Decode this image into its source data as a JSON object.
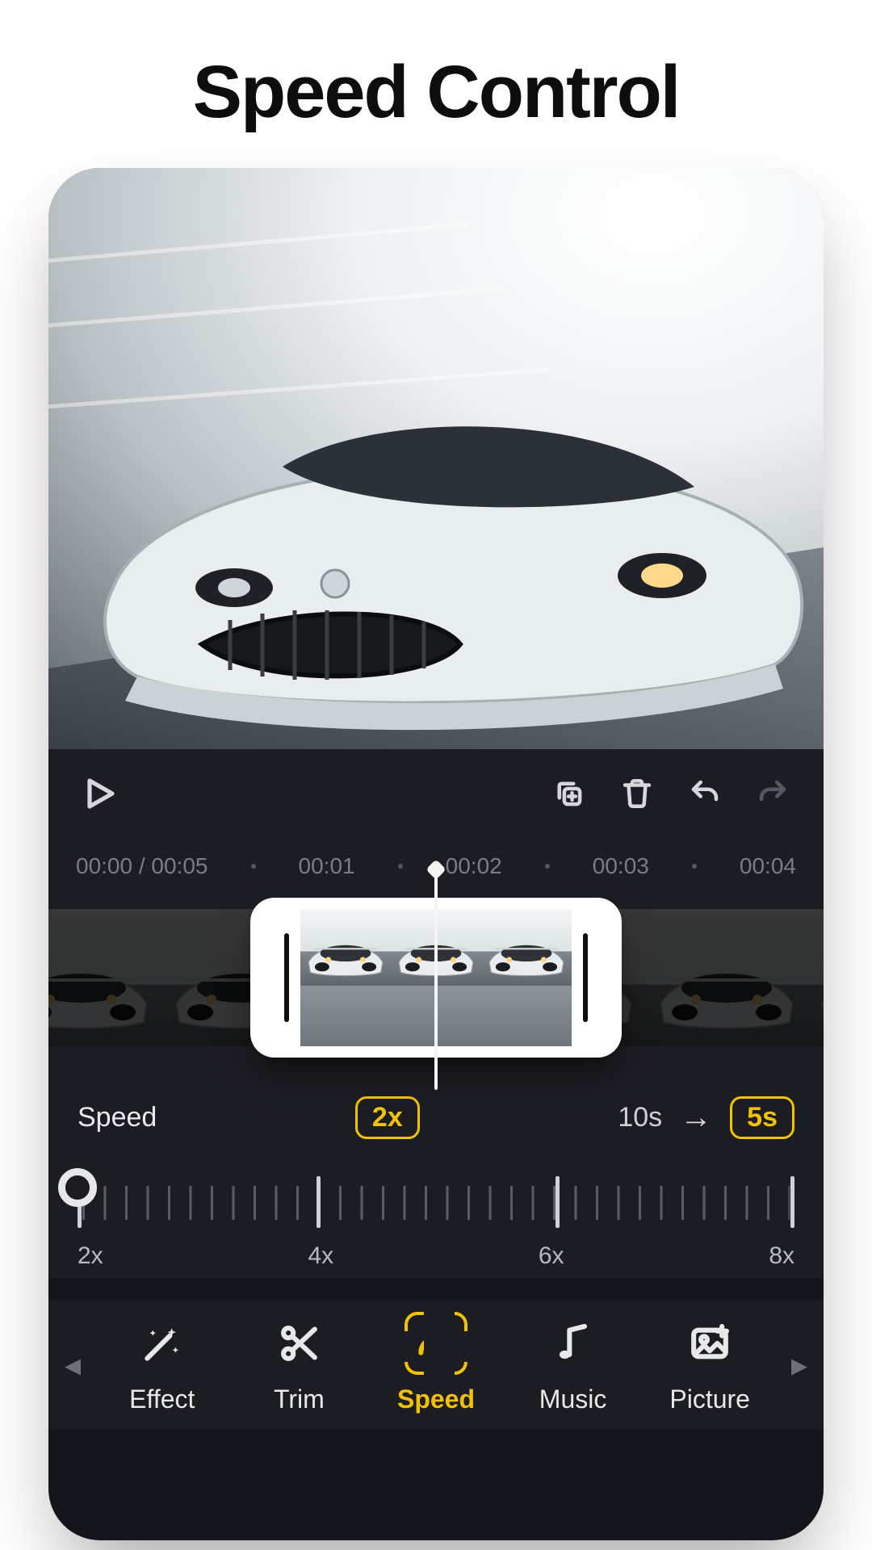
{
  "promo_title": "Speed Control",
  "toolbar": {
    "play_label": "Play",
    "duplicate_label": "Duplicate clip",
    "delete_label": "Delete",
    "undo_label": "Undo",
    "redo_label": "Redo"
  },
  "ruler": {
    "current_and_total": "00:00 / 00:05",
    "marks": [
      "00:01",
      "00:02",
      "00:03",
      "00:04"
    ]
  },
  "speed": {
    "label": "Speed",
    "multiplier": "2x",
    "from_duration": "10s",
    "to_duration": "5s",
    "slider_labels": [
      "2x",
      "4x",
      "6x",
      "8x"
    ],
    "slider_value": "2x"
  },
  "tabs": {
    "items": [
      {
        "id": "effect",
        "label": "Effect",
        "icon": "wand-sparkles-icon",
        "active": false
      },
      {
        "id": "trim",
        "label": "Trim",
        "icon": "scissors-icon",
        "active": false
      },
      {
        "id": "speed",
        "label": "Speed",
        "icon": "gauge-icon",
        "active": true
      },
      {
        "id": "music",
        "label": "Music",
        "icon": "music-note-icon",
        "active": false
      },
      {
        "id": "picture",
        "label": "Picture",
        "icon": "image-plus-icon",
        "active": false
      }
    ]
  },
  "colors": {
    "accent": "#f2c200",
    "panel": "#1c1d23",
    "text": "#e7e8ec",
    "muted": "#7a7c86"
  }
}
